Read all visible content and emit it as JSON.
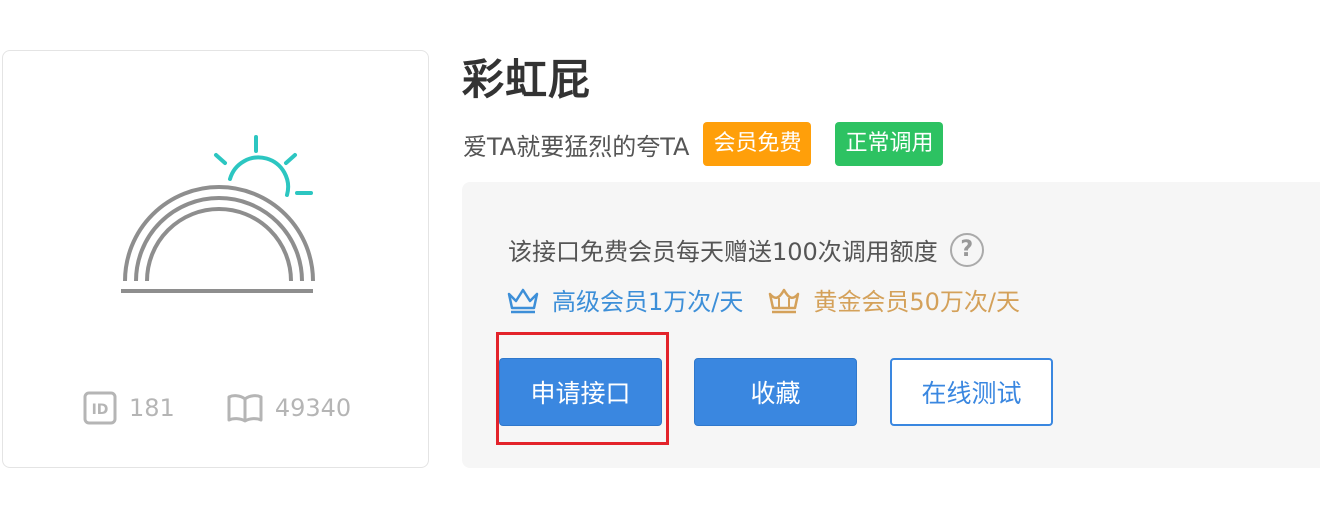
{
  "api": {
    "title": "彩虹屁",
    "subtitle": "爱TA就要猛烈的夸TA",
    "badges": [
      "会员免费",
      "正常调用"
    ],
    "id_value": "181",
    "views_value": "49340"
  },
  "panel": {
    "note": "该接口免费会员每天赠送100次调用额度",
    "help_symbol": "?",
    "tier_senior": "高级会员1万次/天",
    "tier_gold": "黄金会员50万次/天"
  },
  "buttons": {
    "apply": "申请接口",
    "collect": "收藏",
    "test": "在线测试"
  },
  "colors": {
    "accent": "#3a87e0",
    "badge_orange": "#ff9f0a",
    "badge_green": "#2dc262",
    "highlight": "#e3232b",
    "gold": "#d4a15a"
  },
  "icons": {
    "logo": "rainbow-sun-icon",
    "id": "id-badge-icon",
    "views": "open-book-icon",
    "senior": "crown-outline-icon",
    "gold": "crown-gold-icon"
  }
}
